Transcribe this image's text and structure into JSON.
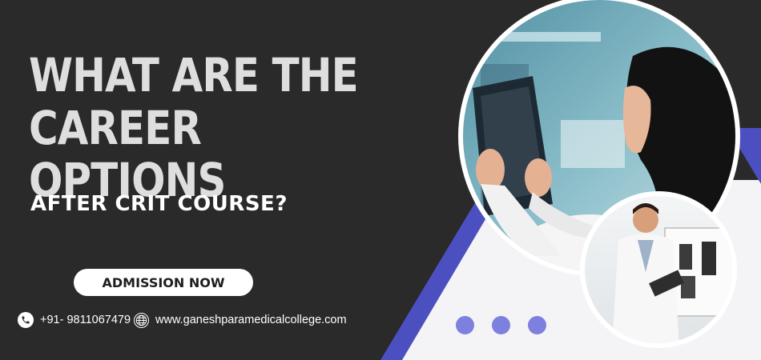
{
  "headline": {
    "line1": "WHAT ARE THE CAREER",
    "line2": "OPTIONS"
  },
  "subheadline": "AFTER CRIT COURSE?",
  "cta": {
    "label": "ADMISSION NOW"
  },
  "contact": {
    "phone": "+91- 9811067479",
    "website": "www.ganeshparamedicalcollege.com"
  },
  "colors": {
    "background": "#2a2a2b",
    "accent": "#4b4fc0",
    "panel": "#f4f4f7",
    "dot": "#7d80de"
  },
  "icons": [
    "phone-icon",
    "globe-icon"
  ]
}
